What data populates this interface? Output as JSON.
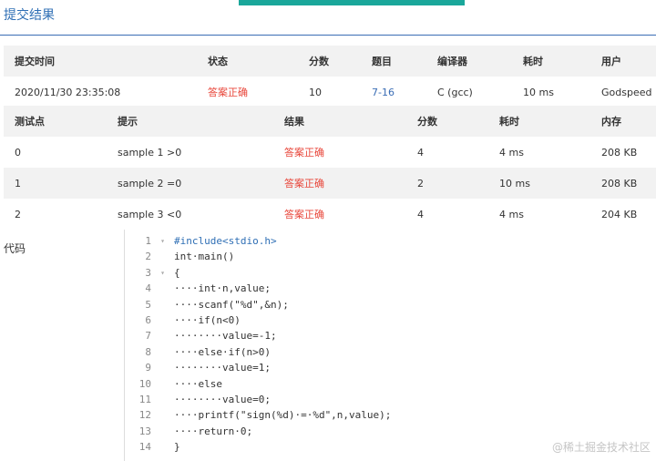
{
  "title": "提交结果",
  "summary": {
    "headers": [
      "提交时间",
      "状态",
      "分数",
      "题目",
      "编译器",
      "耗时",
      "用户"
    ],
    "row": [
      "2020/11/30 23:35:08",
      "答案正确",
      "10",
      "7-16",
      "C (gcc)",
      "10 ms",
      "Godspeed"
    ]
  },
  "cases": {
    "headers": [
      "测试点",
      "提示",
      "结果",
      "分数",
      "耗时",
      "内存"
    ],
    "rows": [
      [
        "0",
        "sample 1 >0",
        "答案正确",
        "4",
        "4 ms",
        "208 KB"
      ],
      [
        "1",
        "sample 2 =0",
        "答案正确",
        "2",
        "10 ms",
        "208 KB"
      ],
      [
        "2",
        "sample 3 <0",
        "答案正确",
        "4",
        "4 ms",
        "204 KB"
      ]
    ]
  },
  "code_label": "代码",
  "code": {
    "lines": [
      {
        "n": "1",
        "fold": "▾",
        "text": "#include<stdio.h>",
        "color": "#2f6fb5"
      },
      {
        "n": "2",
        "fold": "",
        "text": "int·main()",
        "color": "#333333"
      },
      {
        "n": "3",
        "fold": "▾",
        "text": "{",
        "color": "#333333"
      },
      {
        "n": "4",
        "fold": "",
        "text": "····int·n,value;",
        "color": "#333333"
      },
      {
        "n": "5",
        "fold": "",
        "text": "····scanf(\"%d\",&n);",
        "color": "#333333"
      },
      {
        "n": "6",
        "fold": "",
        "text": "····if(n<0)",
        "color": "#333333"
      },
      {
        "n": "7",
        "fold": "",
        "text": "········value=-1;",
        "color": "#333333"
      },
      {
        "n": "8",
        "fold": "",
        "text": "····else·if(n>0)",
        "color": "#333333"
      },
      {
        "n": "9",
        "fold": "",
        "text": "········value=1;",
        "color": "#333333"
      },
      {
        "n": "10",
        "fold": "",
        "text": "····else",
        "color": "#333333"
      },
      {
        "n": "11",
        "fold": "",
        "text": "········value=0;",
        "color": "#333333"
      },
      {
        "n": "12",
        "fold": "",
        "text": "····printf(\"sign(%d)·=·%d\",n,value);",
        "color": "#333333"
      },
      {
        "n": "13",
        "fold": "",
        "text": "····return·0;",
        "color": "#333333"
      },
      {
        "n": "14",
        "fold": "",
        "text": "}",
        "color": "#333333"
      }
    ]
  },
  "watermark": "@稀土掘金技术社区",
  "colors": {
    "accent": "#3a6db5",
    "success_text": "#e8463a",
    "top_bar": "#1aa79a"
  }
}
